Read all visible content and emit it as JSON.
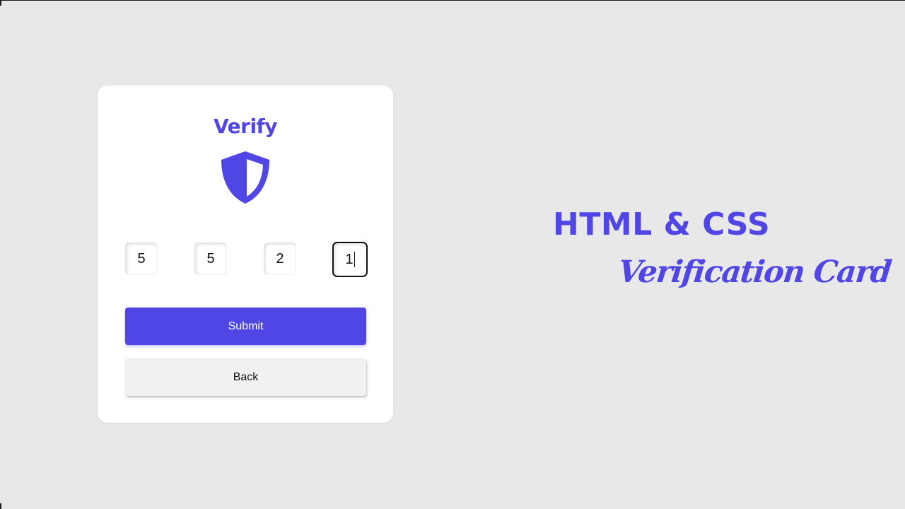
{
  "card": {
    "title": "Verify",
    "shield_icon": "shield-half-icon",
    "otp": [
      "5",
      "5",
      "2",
      "1"
    ],
    "submit_label": "Submit",
    "back_label": "Back"
  },
  "hero": {
    "title": "HTML & CSS",
    "subtitle": "Verification Card"
  },
  "colors": {
    "accent": "#4f46e5",
    "background": "#e8e8e8",
    "card": "#ffffff",
    "back_button": "#f1f1f1"
  }
}
